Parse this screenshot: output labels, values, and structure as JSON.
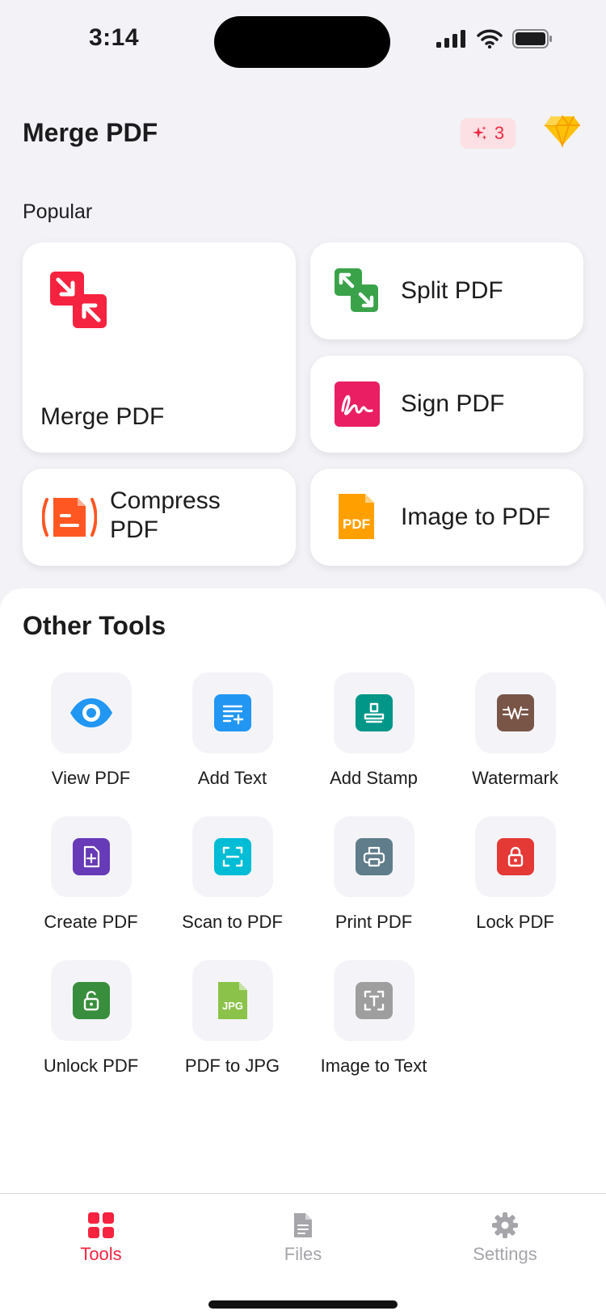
{
  "status": {
    "time": "3:14"
  },
  "header": {
    "title": "Merge PDF",
    "credits": "3"
  },
  "popular": {
    "label": "Popular",
    "cards": [
      {
        "label": "Merge PDF",
        "icon": "merge-icon",
        "color": "#f5233f"
      },
      {
        "label": "Split PDF",
        "icon": "split-icon",
        "color": "#3aa34a"
      },
      {
        "label": "Sign PDF",
        "icon": "signature-icon",
        "color": "#e91e63"
      },
      {
        "label": "Compress PDF",
        "icon": "compress-icon",
        "color": "#ff5722"
      },
      {
        "label": "Image to PDF",
        "icon": "pdf-file-icon",
        "color": "#ffa000"
      }
    ]
  },
  "other": {
    "title": "Other Tools",
    "tools": [
      {
        "label": "View PDF",
        "icon": "eye-icon",
        "color": "#2196f3"
      },
      {
        "label": "Add Text",
        "icon": "add-text-icon",
        "color": "#2196f3"
      },
      {
        "label": "Add Stamp",
        "icon": "stamp-icon",
        "color": "#009688"
      },
      {
        "label": "Watermark",
        "icon": "watermark-icon",
        "color": "#795548"
      },
      {
        "label": "Create PDF",
        "icon": "create-file-icon",
        "color": "#673ab7"
      },
      {
        "label": "Scan to PDF",
        "icon": "scan-icon",
        "color": "#00bcd4"
      },
      {
        "label": "Print PDF",
        "icon": "printer-icon",
        "color": "#607d8b"
      },
      {
        "label": "Lock PDF",
        "icon": "lock-icon",
        "color": "#e53935"
      },
      {
        "label": "Unlock PDF",
        "icon": "unlock-icon",
        "color": "#388e3c"
      },
      {
        "label": "PDF to JPG",
        "icon": "jpg-file-icon",
        "color": "#8bc34a"
      },
      {
        "label": "Image to Text",
        "icon": "ocr-icon",
        "color": "#9e9e9e"
      }
    ]
  },
  "tabbar": {
    "tabs": [
      {
        "label": "Tools",
        "icon": "grid-icon",
        "active": true
      },
      {
        "label": "Files",
        "icon": "document-icon",
        "active": false
      },
      {
        "label": "Settings",
        "icon": "gear-icon",
        "active": false
      }
    ]
  },
  "colors": {
    "accent": "#f5233f",
    "inactive": "#a5a5aa"
  }
}
